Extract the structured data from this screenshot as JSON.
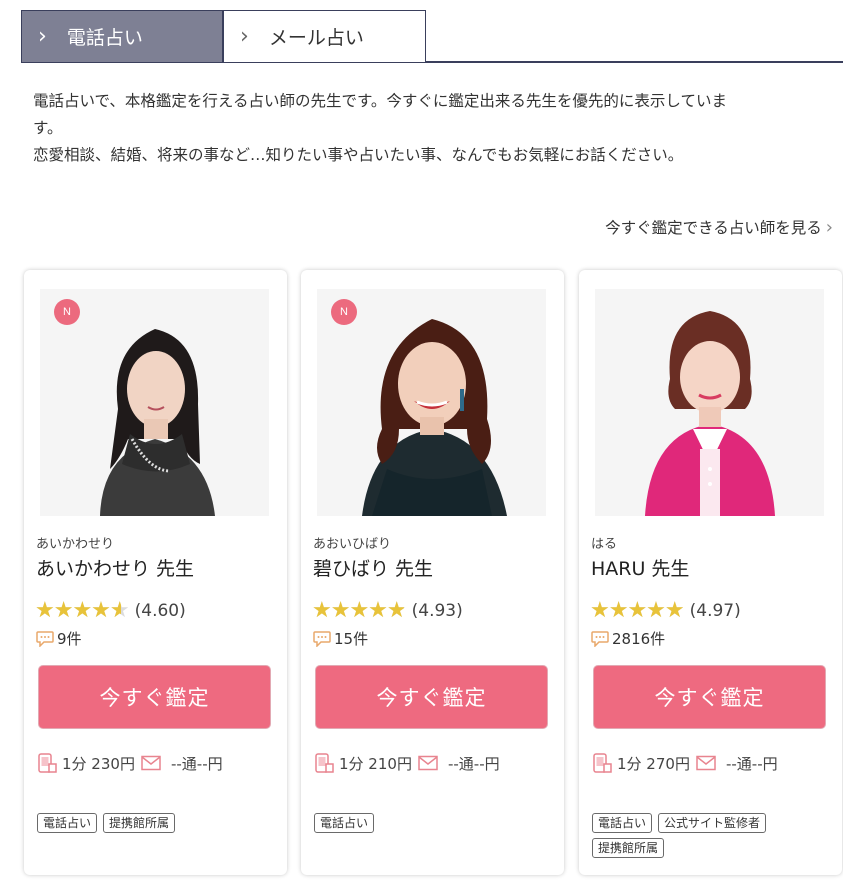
{
  "tabs": [
    {
      "label": "電話占い",
      "active": true
    },
    {
      "label": "メール占い",
      "active": false
    }
  ],
  "intro": {
    "line1": "電話占いで、本格鑑定を行える占い師の先生です。今すぐに鑑定出来る先生を優先的に表示していま",
    "line2": "す。",
    "line3": "恋愛相談、結婚、将来の事など…知りたい事や占いたい事、なんでもお気軽にお話ください。"
  },
  "more_link": "今すぐ鑑定できる占い師を見る",
  "colors": {
    "accent": "#ee6a80",
    "tab_active": "#7e8094",
    "star": "#e8c33a",
    "new_badge": "#ec6a7e"
  },
  "cards": [
    {
      "new_badge": "N",
      "kana": "あいかわせり",
      "name": "あいかわせり 先生",
      "rating": 4.6,
      "rating_text": "(4.60)",
      "reviews": "9件",
      "button": "今すぐ鑑定",
      "phone_price": "1分 230円",
      "mail_price": "--通--円",
      "tags": [
        "電話占い",
        "提携館所属"
      ]
    },
    {
      "new_badge": "N",
      "kana": "あおいひばり",
      "name": "碧ひばり 先生",
      "rating": 4.93,
      "rating_text": "(4.93)",
      "reviews": "15件",
      "button": "今すぐ鑑定",
      "phone_price": "1分 210円",
      "mail_price": "--通--円",
      "tags": [
        "電話占い"
      ]
    },
    {
      "new_badge": "",
      "kana": "はる",
      "name": "HARU 先生",
      "rating": 4.97,
      "rating_text": "(4.97)",
      "reviews": "2816件",
      "button": "今すぐ鑑定",
      "phone_price": "1分 270円",
      "mail_price": "--通--円",
      "tags": [
        "電話占い",
        "公式サイト監修者",
        "提携館所属"
      ]
    }
  ],
  "icons": {
    "tab_chevron": "chevron-right-icon",
    "review": "speech-bubble-icon",
    "phone": "phone-icon",
    "mail": "mail-icon"
  }
}
